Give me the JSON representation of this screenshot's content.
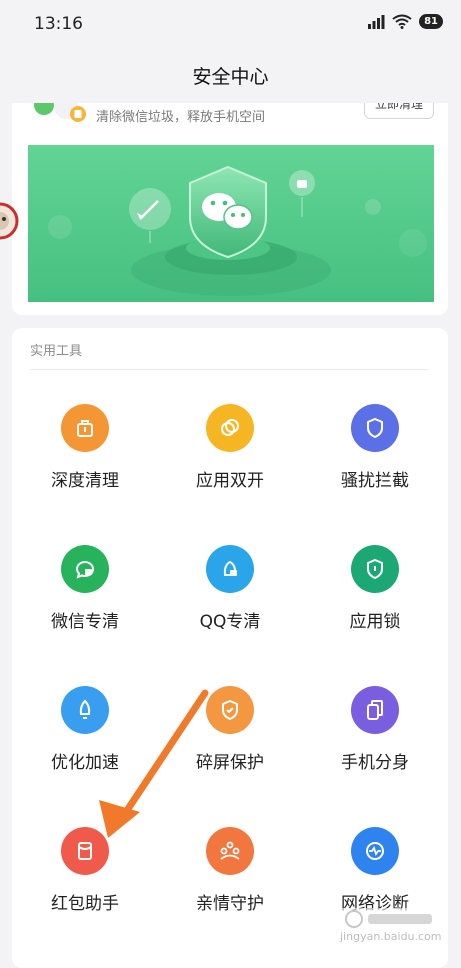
{
  "status_bar": {
    "time": "13:16",
    "battery": "81"
  },
  "header": {
    "title": "安全中心"
  },
  "clean_card": {
    "description": "清除微信垃圾，释放手机空间",
    "button": "立即清理"
  },
  "tools": {
    "section_title": "实用工具",
    "items": [
      {
        "label": "深度清理",
        "icon": "bag-icon",
        "color": "#f39633"
      },
      {
        "label": "应用双开",
        "icon": "dual-circle-icon",
        "color": "#f6b522"
      },
      {
        "label": "骚扰拦截",
        "icon": "shield-icon",
        "color": "#5b6fe6"
      },
      {
        "label": "微信专清",
        "icon": "wechat-clean-icon",
        "color": "#27b35c"
      },
      {
        "label": "QQ专清",
        "icon": "qq-clean-icon",
        "color": "#2aa5ea"
      },
      {
        "label": "应用锁",
        "icon": "lock-shield-icon",
        "color": "#1ba874"
      },
      {
        "label": "优化加速",
        "icon": "rocket-icon",
        "color": "#3a9ef0"
      },
      {
        "label": "碎屏保护",
        "icon": "shield-check-icon",
        "color": "#f39740"
      },
      {
        "label": "手机分身",
        "icon": "phone-copy-icon",
        "color": "#7a5ee0"
      },
      {
        "label": "红包助手",
        "icon": "red-envelope-icon",
        "color": "#ef5a4a"
      },
      {
        "label": "亲情守护",
        "icon": "family-icon",
        "color": "#f2773f"
      },
      {
        "label": "网络诊断",
        "icon": "network-icon",
        "color": "#2f83ee"
      }
    ]
  },
  "watermark": {
    "text": "jingyan.baidu.com"
  }
}
